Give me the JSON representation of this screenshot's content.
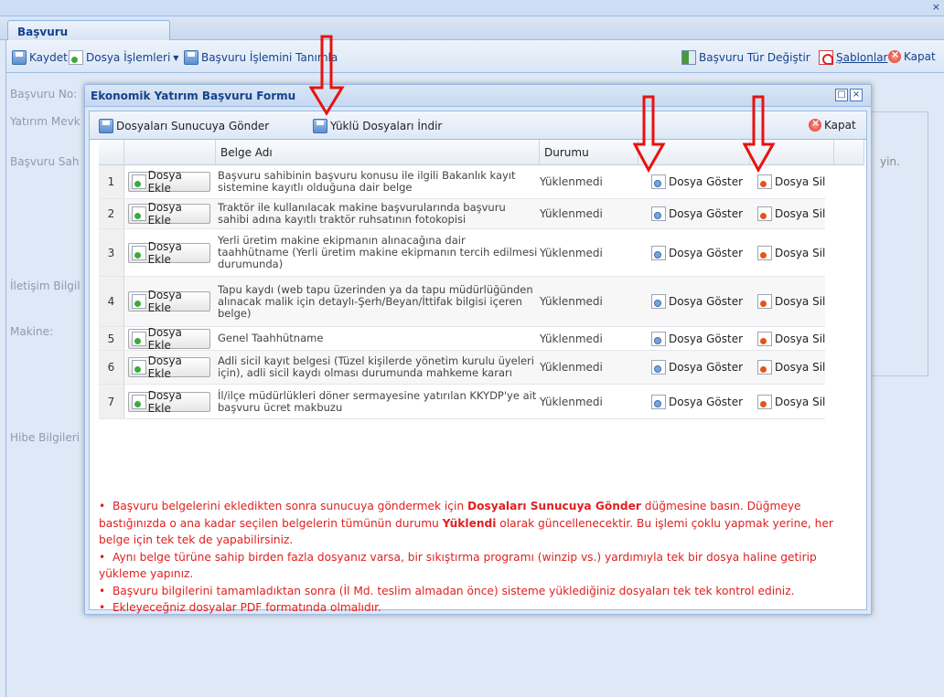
{
  "app": {
    "tab_label": "Başvuru",
    "close_glyph": "×"
  },
  "main_toolbar": {
    "save": "Kaydet",
    "file_ops": "Dosya İşlemleri",
    "define": "Başvuru İşlemini Tanımla",
    "change_type": "Başvuru Tür Değiştir",
    "templates": "Şablonlar",
    "close": "Kapat"
  },
  "form_labels": [
    "Başvuru No:",
    "Yatırım Mevk",
    "Başvuru Sah",
    "İletişim Bilgil",
    "Makine:",
    "Hibe Bilgileri"
  ],
  "background_text": "yin.",
  "modal": {
    "title": "Ekonomik Yatırım Başvuru Formu",
    "toolbar": {
      "send": "Dosyaları Sunucuya Gönder",
      "download": "Yüklü Dosyaları İndir",
      "close": "Kapat"
    },
    "columns": {
      "name": "Belge Adı",
      "status": "Durumu"
    },
    "add_label": "Dosya Ekle",
    "show_label": "Dosya Göster",
    "delete_label": "Dosya Sil",
    "rows": [
      {
        "num": "1",
        "name": "Başvuru sahibinin başvuru konusu ile ilgili Bakanlık kayıt sistemine kayıtlı olduğuna dair belge",
        "status": "Yüklenmedi"
      },
      {
        "num": "2",
        "name": "Traktör ile kullanılacak makine başvurularında başvuru sahibi adına kayıtlı traktör ruhsatının fotokopisi",
        "status": "Yüklenmedi"
      },
      {
        "num": "3",
        "name": "Yerli üretim makine ekipmanın alınacağına dair taahhütname (Yerli üretim makine ekipmanın tercih edilmesi durumunda)",
        "status": "Yüklenmedi"
      },
      {
        "num": "4",
        "name": "Tapu kaydı (web tapu üzerinden ya da tapu müdürlüğünden alınacak malik için detaylı-Şerh/Beyan/İttifak bilgisi içeren belge)",
        "status": "Yüklenmedi"
      },
      {
        "num": "5",
        "name": "Genel Taahhütname",
        "status": "Yüklenmedi"
      },
      {
        "num": "6",
        "name": "Adli sicil kayıt belgesi (Tüzel kişilerde yönetim kurulu üyeleri için), adli sicil kaydı olması durumunda mahkeme kararı",
        "status": "Yüklenmedi"
      },
      {
        "num": "7",
        "name": "İl/ilçe müdürlükleri döner sermayesine yatırılan KKYDP'ye ait başvuru ücret makbuzu",
        "status": "Yüklenmedi"
      }
    ],
    "notes": {
      "n1_a": "Başvuru belgelerini ekledikten sonra sunucuya göndermek için ",
      "n1_b": "Dosyaları Sunucuya Gönder",
      "n1_c": " düğmesine basın. Düğmeye bastığınızda o ana kadar seçilen belgelerin tümünün durumu ",
      "n1_d": "Yüklendi",
      "n1_e": " olarak güncellenecektir. Bu işlemi çoklu yapmak yerine, her belge için tek tek de yapabilirsiniz.",
      "n2": "Aynı belge türüne sahip birden fazla dosyanız varsa, bir sıkıştırma programı (winzip vs.) yardımıyla tek bir dosya haline getirip yükleme yapınız.",
      "n3": "Başvuru bilgilerini tamamladıktan sonra (İl Md. teslim almadan önce) sisteme yüklediğiniz dosyaları tek tek kontrol ediniz.",
      "n4": "Ekleyeceğniz dosyalar PDF formatında olmalıdır."
    }
  },
  "colors": {
    "accent": "#15428b",
    "note_red": "#e0201f",
    "arrow_red": "#e8120c"
  }
}
